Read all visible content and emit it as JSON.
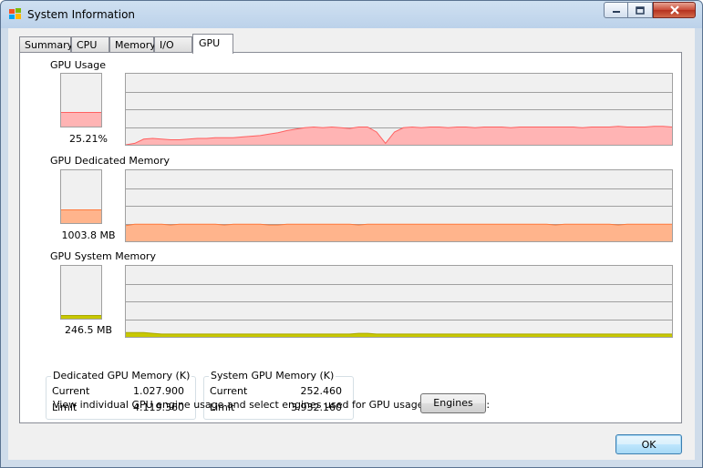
{
  "window": {
    "title": "System Information",
    "caption_buttons": [
      "minimize-icon",
      "maximize-icon",
      "close-icon"
    ]
  },
  "tabs": [
    {
      "label": "Summary",
      "active": false
    },
    {
      "label": "CPU",
      "active": false
    },
    {
      "label": "Memory",
      "active": false
    },
    {
      "label": "I/O",
      "active": false
    },
    {
      "label": "GPU",
      "active": true
    }
  ],
  "sections": {
    "gpu_usage": {
      "title": "GPU Usage",
      "value_text": "25.21%",
      "level": 0.2521,
      "fill_color": "#ffb4b4",
      "line_color": "#ff6060"
    },
    "dedicated": {
      "title": "GPU Dedicated Memory",
      "value_text": "1003.8 MB",
      "level": 0.24,
      "fill_color": "#ffb48c",
      "line_color": "#ff7a3c"
    },
    "system": {
      "title": "GPU System Memory",
      "value_text": "246.5 MB",
      "level": 0.06,
      "fill_color": "#c8c800",
      "line_color": "#a8a800"
    }
  },
  "groups": {
    "dedicated": {
      "title": "Dedicated GPU Memory (K)",
      "rows": [
        {
          "label": "Current",
          "value": "1.027.900"
        },
        {
          "label": "Limit",
          "value": "4.119.360"
        }
      ]
    },
    "system": {
      "title": "System GPU Memory (K)",
      "rows": [
        {
          "label": "Current",
          "value": "252.460"
        },
        {
          "label": "Limit",
          "value": "3.932.160"
        }
      ]
    }
  },
  "footer": {
    "info_text": "View individual GPU engine usage and select engines used for GPU usage calculations:",
    "engines_label": "Engines",
    "ok_label": "OK"
  },
  "history": {
    "gpu_usage": [
      0,
      0.02,
      0.08,
      0.09,
      0.08,
      0.07,
      0.07,
      0.08,
      0.09,
      0.09,
      0.1,
      0.1,
      0.1,
      0.11,
      0.12,
      0.13,
      0.15,
      0.17,
      0.2,
      0.22,
      0.24,
      0.25,
      0.24,
      0.25,
      0.24,
      0.23,
      0.25,
      0.25,
      0.18,
      0.02,
      0.18,
      0.24,
      0.25,
      0.24,
      0.25,
      0.25,
      0.24,
      0.25,
      0.25,
      0.24,
      0.25,
      0.25,
      0.25,
      0.24,
      0.25,
      0.25,
      0.25,
      0.25,
      0.25,
      0.25,
      0.25,
      0.24,
      0.25,
      0.25,
      0.25,
      0.26,
      0.25,
      0.25,
      0.25,
      0.26,
      0.26,
      0.25
    ],
    "dedicated": [
      0.22,
      0.24,
      0.24,
      0.24,
      0.24,
      0.23,
      0.24,
      0.24,
      0.24,
      0.24,
      0.24,
      0.23,
      0.24,
      0.24,
      0.24,
      0.24,
      0.23,
      0.23,
      0.24,
      0.24,
      0.24,
      0.24,
      0.24,
      0.24,
      0.24,
      0.24,
      0.23,
      0.24,
      0.24,
      0.24,
      0.24,
      0.24,
      0.24,
      0.24,
      0.24,
      0.24,
      0.24,
      0.24,
      0.24,
      0.24,
      0.24,
      0.24,
      0.24,
      0.24,
      0.24,
      0.24,
      0.24,
      0.24,
      0.23,
      0.24,
      0.24,
      0.24,
      0.24,
      0.24,
      0.24,
      0.23,
      0.24,
      0.24,
      0.24,
      0.24,
      0.24,
      0.24
    ],
    "system": [
      0.06,
      0.06,
      0.06,
      0.05,
      0.04,
      0.04,
      0.04,
      0.04,
      0.04,
      0.04,
      0.04,
      0.04,
      0.04,
      0.04,
      0.04,
      0.04,
      0.04,
      0.04,
      0.04,
      0.04,
      0.04,
      0.04,
      0.04,
      0.04,
      0.04,
      0.04,
      0.05,
      0.05,
      0.04,
      0.04,
      0.04,
      0.04,
      0.04,
      0.04,
      0.04,
      0.04,
      0.04,
      0.04,
      0.04,
      0.04,
      0.04,
      0.04,
      0.04,
      0.04,
      0.04,
      0.04,
      0.04,
      0.04,
      0.04,
      0.04,
      0.04,
      0.04,
      0.04,
      0.04,
      0.04,
      0.04,
      0.04,
      0.04,
      0.04,
      0.04,
      0.04,
      0.04
    ]
  }
}
